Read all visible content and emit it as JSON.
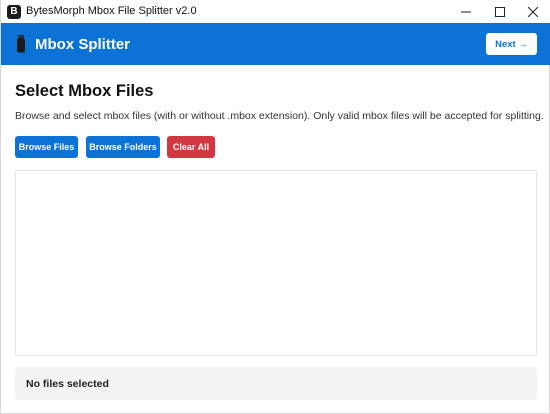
{
  "window": {
    "title": "BytesMorph Mbox File Splitter v2.0",
    "app_icon_letter": "B",
    "controls": [
      "minimize-icon",
      "maximize-icon",
      "close-icon"
    ]
  },
  "header": {
    "title": "Mbox Splitter",
    "icon": "usb-drive-icon",
    "next_label": "Next →",
    "background": "#0d72d6"
  },
  "main": {
    "title": "Select Mbox Files",
    "description": "Browse and select mbox files (with or without .mbox extension). Only valid mbox files will be accepted for splitting.",
    "buttons": {
      "browse_files": "Browse Files",
      "browse_folders": "Browse Folders",
      "clear_all": "Clear All"
    },
    "file_list": [],
    "status": "No files selected"
  },
  "colors": {
    "primary": "#0d72d6",
    "danger": "#d1383f",
    "status_bg": "#f3f3f3"
  }
}
